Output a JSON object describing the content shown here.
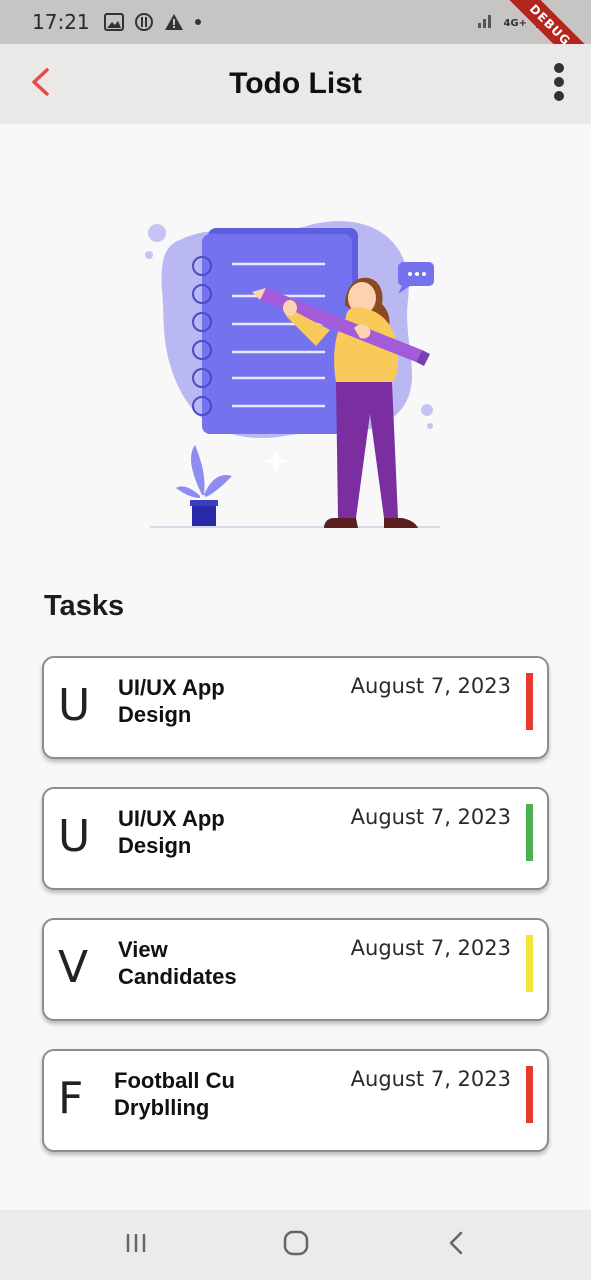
{
  "status_bar": {
    "time": "17:21",
    "network": "4G+"
  },
  "debug_banner": "DEBUG",
  "app_bar": {
    "title": "Todo List"
  },
  "tasks_section": {
    "title": "Tasks"
  },
  "tasks": [
    {
      "initial": "U",
      "title": "UI/UX App Design",
      "date": "August 7, 2023",
      "priority_color": "#e53b2f"
    },
    {
      "initial": "U",
      "title": "UI/UX App Design",
      "date": "August 7, 2023",
      "priority_color": "#4caf50"
    },
    {
      "initial": "V",
      "title": "View Candidates",
      "date": "August 7, 2023",
      "priority_color": "#f2e535"
    },
    {
      "initial": "F",
      "title": "Football Cu Dryblling",
      "date": "August 7, 2023",
      "priority_color": "#e53b2f"
    }
  ],
  "colors": {
    "accent": "#e54b4b",
    "app_bar_bg": "#ebe9e7",
    "page_bg": "#f8f8f8"
  },
  "icons": {
    "back": "chevron-left-icon",
    "more": "more-vertical-icon",
    "nav_recents": "recents-icon",
    "nav_home": "home-icon",
    "nav_back": "back-icon"
  }
}
